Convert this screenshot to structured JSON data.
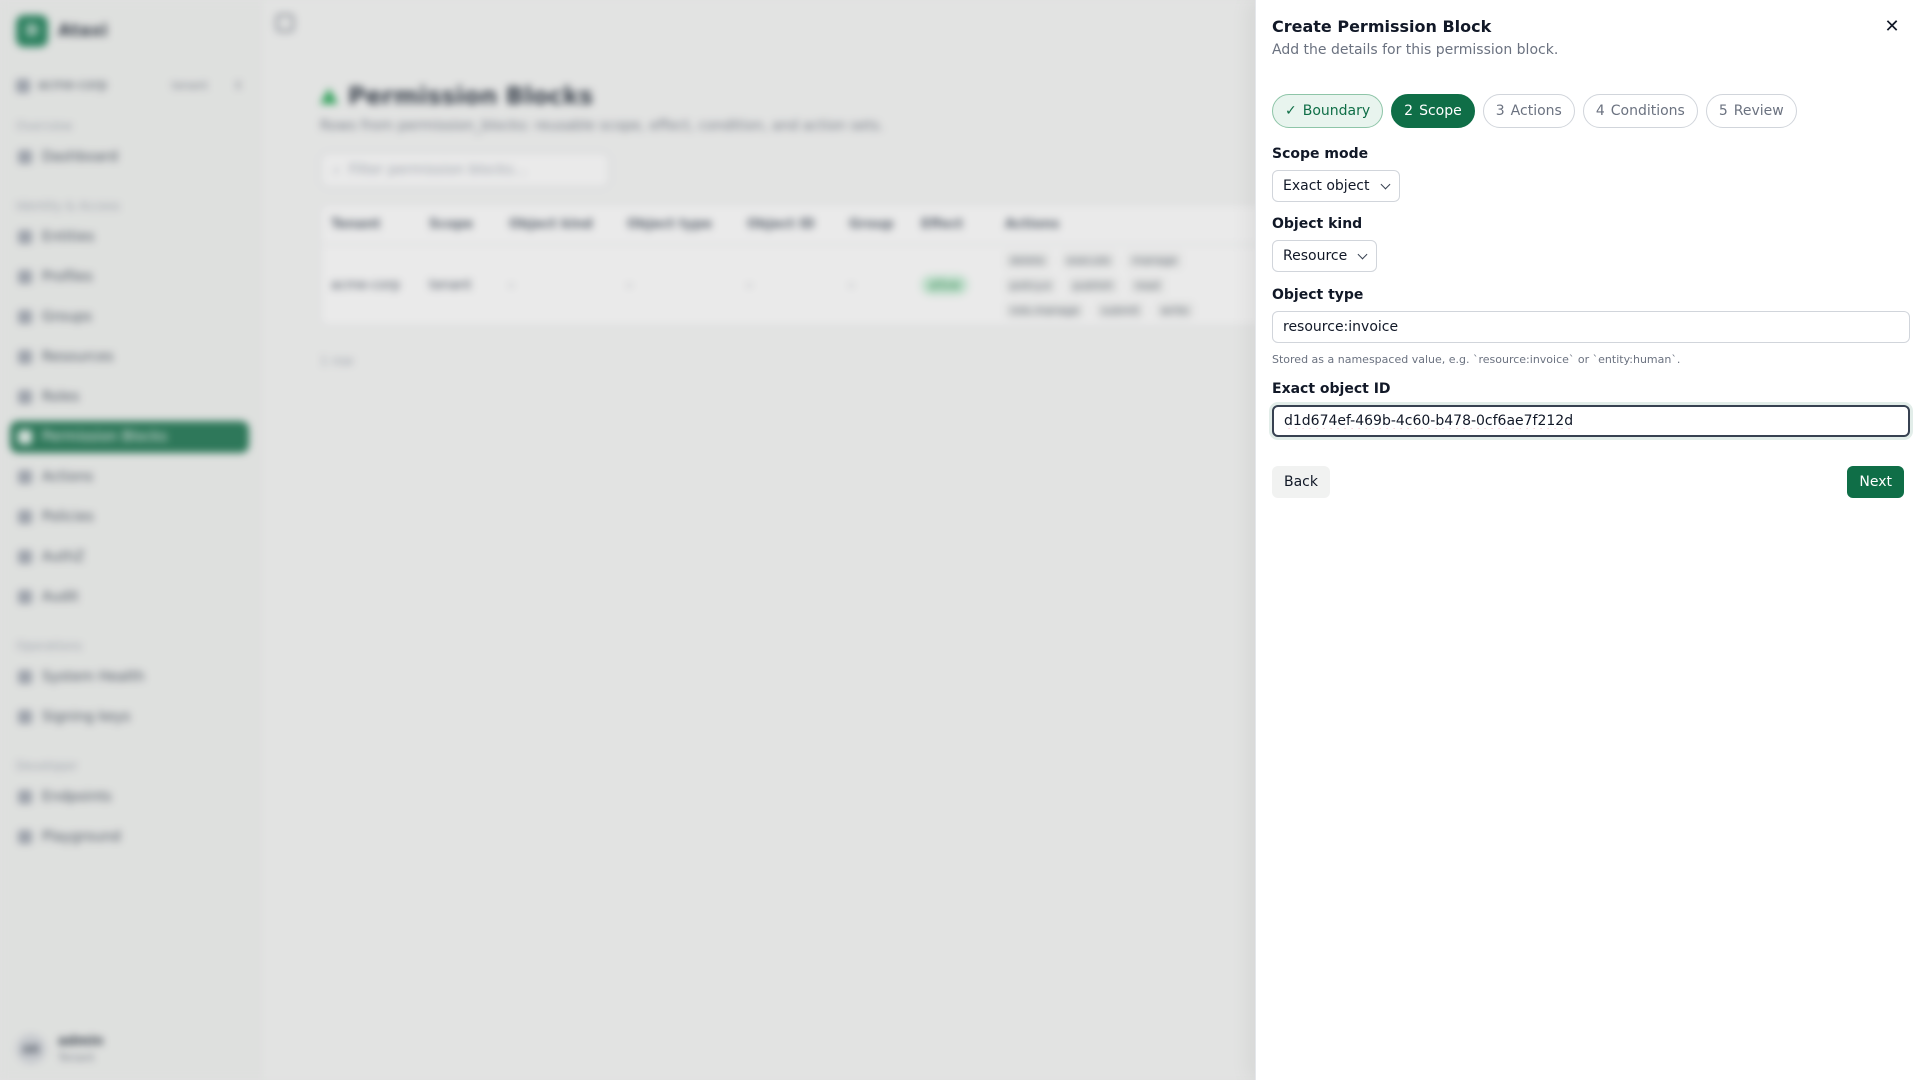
{
  "app": {
    "brand_initial": "D",
    "brand_name": "Ataxi",
    "tenant": "acme-corp",
    "tenant_badge": "tenant",
    "sections": {
      "overview": "Overview",
      "identity": "Identity & Access",
      "operations": "Operations",
      "developer": "Developer"
    },
    "nav": {
      "dashboard": "Dashboard",
      "entities": "Entities",
      "profiles": "Profiles",
      "groups": "Groups",
      "resources": "Resources",
      "roles": "Roles",
      "permission_blocks": "Permission Blocks",
      "actions": "Actions",
      "policies": "Policies",
      "authz": "AuthZ",
      "audit": "Audit",
      "system_health": "System Health",
      "signing_keys": "Signing keys",
      "endpoints": "Endpoints",
      "playground": "Playground"
    },
    "user": {
      "initials": "AR",
      "name": "admin",
      "role": "Tenant"
    }
  },
  "page": {
    "title": "Permission Blocks",
    "subtitle": "Rows from permission_blocks: reusable scope, effect, condition, and action sets.",
    "filter_placeholder": "Filter permission blocks...",
    "columns": [
      "Tenant",
      "Scope",
      "Object kind",
      "Object type",
      "Object ID",
      "Group",
      "Effect",
      "Actions"
    ],
    "row": {
      "tenant": "acme-corp",
      "scope": "tenant",
      "object_kind": "-",
      "object_type": "-",
      "object_id": "-",
      "group": "-",
      "effect": "allow",
      "actions": [
        "delete",
        "execute",
        "manage",
        "policy.e",
        "publish",
        "read",
        "role.manage",
        "submit",
        "write"
      ]
    },
    "row_count": "1 row"
  },
  "drawer": {
    "title": "Create Permission Block",
    "description": "Add the details for this permission block.",
    "steps": [
      {
        "number": "",
        "label": "Boundary",
        "state": "done"
      },
      {
        "number": "2",
        "label": "Scope",
        "state": "current"
      },
      {
        "number": "3",
        "label": "Actions",
        "state": "upcoming"
      },
      {
        "number": "4",
        "label": "Conditions",
        "state": "upcoming"
      },
      {
        "number": "5",
        "label": "Review",
        "state": "upcoming"
      }
    ],
    "scope_mode": {
      "label": "Scope mode",
      "value": "Exact object"
    },
    "object_kind": {
      "label": "Object kind",
      "value": "Resource"
    },
    "object_type": {
      "label": "Object type",
      "value": "resource:invoice",
      "hint": "Stored as a namespaced value, e.g. `resource:invoice` or `entity:human`."
    },
    "exact_object_id": {
      "label": "Exact object ID",
      "value": "d1d674ef-469b-4c60-b478-0cf6ae7f212d"
    },
    "back_label": "Back",
    "next_label": "Next"
  },
  "colors": {
    "accent": "#0f6e47",
    "accent_light": "#e8f4ee"
  }
}
